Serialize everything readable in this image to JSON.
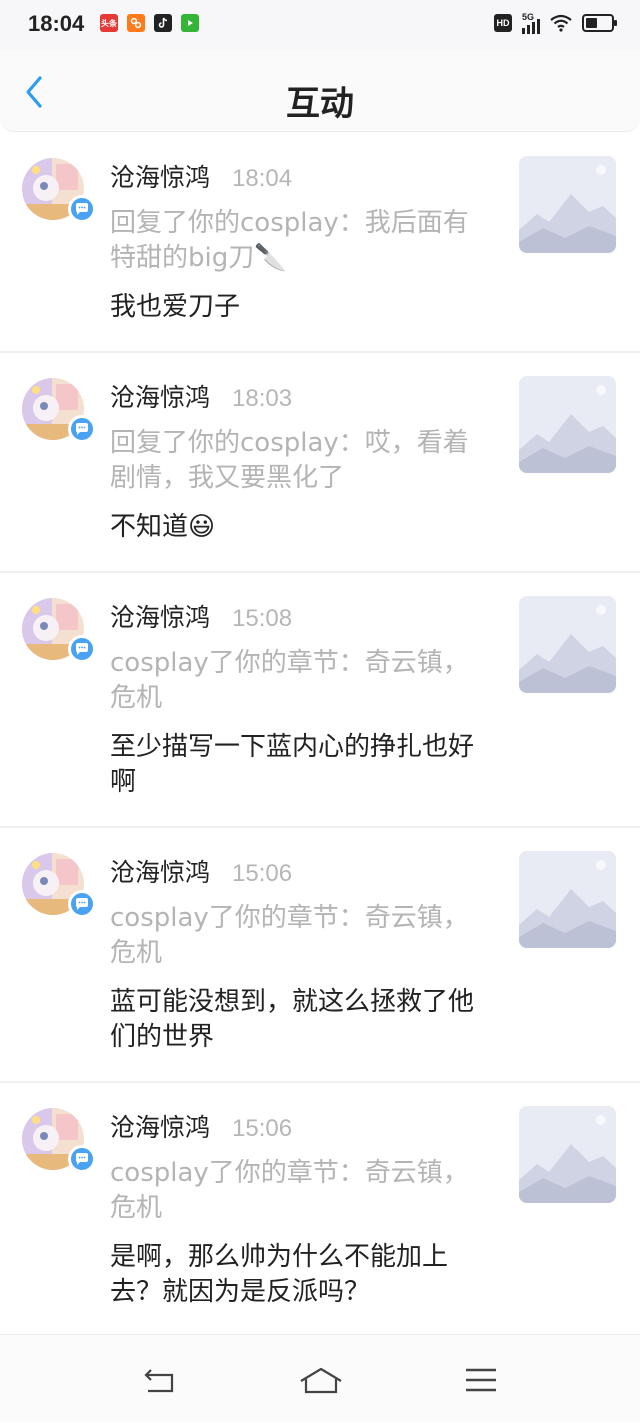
{
  "status_bar": {
    "time": "18:04",
    "notif_icons": [
      {
        "icon": "toutiao-icon",
        "label": "头条",
        "color": "#e53935"
      },
      {
        "icon": "app-icon-orange",
        "label": "",
        "color": "#ff7a1a"
      },
      {
        "icon": "tiktok-icon",
        "label": "",
        "color": "#222222"
      },
      {
        "icon": "iqiyi-icon",
        "label": "",
        "color": "#35b535"
      }
    ],
    "hd_label": "HD",
    "network": "5G",
    "battery_level": 0.45
  },
  "header": {
    "title": "互动",
    "back_icon": "chevron-left-icon",
    "accent": "#2b9cf2"
  },
  "messages": [
    {
      "name": "沧海惊鸿",
      "time": "18:04",
      "quote": "回复了你的cosplay：我后面有特甜的big刀🔪",
      "reply": "我也爱刀子"
    },
    {
      "name": "沧海惊鸿",
      "time": "18:03",
      "quote": "回复了你的cosplay：哎，看着剧情，我又要黑化了",
      "reply": "不知道😃"
    },
    {
      "name": "沧海惊鸿",
      "time": "15:08",
      "quote": "cosplay了你的章节：奇云镇，危机",
      "reply": "至少描写一下蓝内心的挣扎也好啊"
    },
    {
      "name": "沧海惊鸿",
      "time": "15:06",
      "quote": "cosplay了你的章节：奇云镇，危机",
      "reply": "蓝可能没想到，就这么拯救了他们的世界"
    },
    {
      "name": "沧海惊鸿",
      "time": "15:06",
      "quote": "cosplay了你的章节：奇云镇，危机",
      "reply": "是啊，那么帅为什么不能加上去？就因为是反派吗？"
    }
  ],
  "bottom_nav": {
    "icons": [
      "back-nav-icon",
      "home-nav-icon",
      "menu-nav-icon"
    ]
  }
}
